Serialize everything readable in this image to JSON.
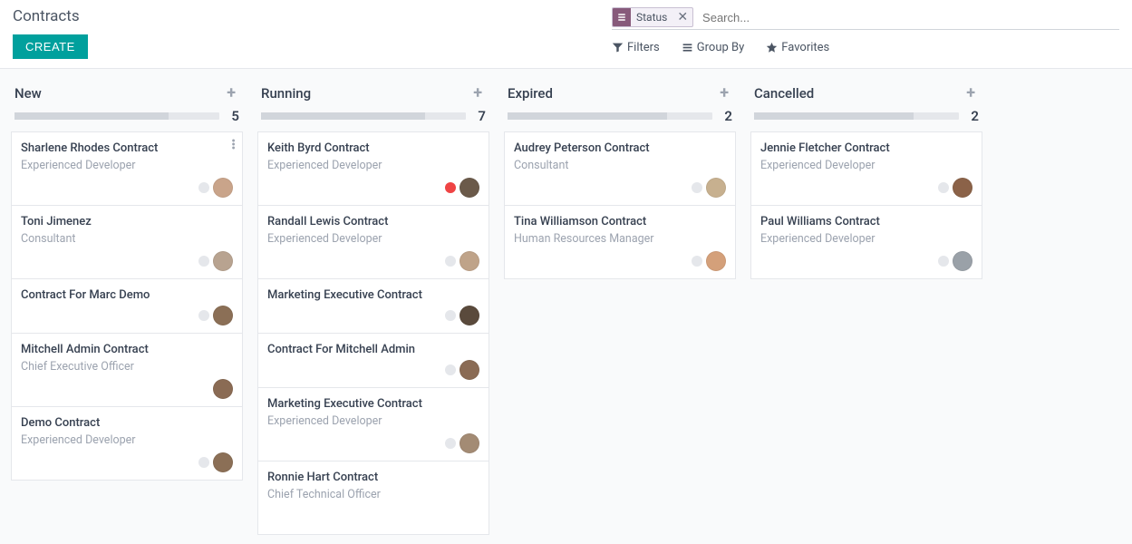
{
  "header": {
    "title": "Contracts",
    "create_label": "CREATE",
    "search_placeholder": "Search...",
    "facet_label": "Status",
    "filters_label": "Filters",
    "groupby_label": "Group By",
    "favorites_label": "Favorites"
  },
  "columns": [
    {
      "title": "New",
      "count": "5",
      "bar_width": "75%",
      "cards": [
        {
          "title": "Sharlene Rhodes Contract",
          "sub": "Experienced Developer",
          "dot": "grey",
          "avatar": "#c9a48a",
          "kebab": true
        },
        {
          "title": "Toni Jimenez",
          "sub": "Consultant",
          "dot": "grey",
          "avatar": "#b8a390"
        },
        {
          "title": "Contract For Marc Demo",
          "sub": "",
          "dot": "grey",
          "avatar": "#8b6f56"
        },
        {
          "title": "Mitchell Admin Contract",
          "sub": "Chief Executive Officer",
          "dot": "",
          "avatar": "#8a6b54"
        },
        {
          "title": "Demo Contract",
          "sub": "Experienced Developer",
          "dot": "grey",
          "avatar": "#8b6f56"
        }
      ]
    },
    {
      "title": "Running",
      "count": "7",
      "bar_width": "80%",
      "cards": [
        {
          "title": "Keith Byrd Contract",
          "sub": "Experienced Developer",
          "dot": "red",
          "avatar": "#6b5a4a"
        },
        {
          "title": "Randall Lewis Contract",
          "sub": "Experienced Developer",
          "dot": "grey",
          "avatar": "#bfa389"
        },
        {
          "title": "Marketing Executive Contract",
          "sub": "",
          "dot": "grey",
          "avatar": "#5a4a3c"
        },
        {
          "title": "Contract For Mitchell Admin",
          "sub": "",
          "dot": "grey",
          "avatar": "#8a6b54"
        },
        {
          "title": "Marketing Executive Contract",
          "sub": "Experienced Developer",
          "dot": "grey",
          "avatar": "#a38b74"
        },
        {
          "title": "Ronnie Hart Contract",
          "sub": "Chief Technical Officer",
          "dot": "",
          "avatar": ""
        }
      ]
    },
    {
      "title": "Expired",
      "count": "2",
      "bar_width": "78%",
      "cards": [
        {
          "title": "Audrey Peterson Contract",
          "sub": "Consultant",
          "dot": "grey",
          "avatar": "#c7b08f"
        },
        {
          "title": "Tina Williamson Contract",
          "sub": "Human Resources Manager",
          "dot": "grey",
          "avatar": "#d4a07a"
        }
      ]
    },
    {
      "title": "Cancelled",
      "count": "2",
      "bar_width": "78%",
      "cards": [
        {
          "title": "Jennie Fletcher Contract",
          "sub": "Experienced Developer",
          "dot": "grey",
          "avatar": "#8b6248"
        },
        {
          "title": "Paul Williams Contract",
          "sub": "Experienced Developer",
          "dot": "grey",
          "avatar": "#9aa1a8"
        }
      ]
    }
  ]
}
